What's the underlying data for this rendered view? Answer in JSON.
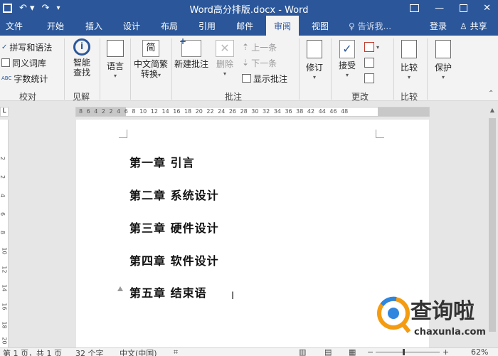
{
  "window": {
    "title": "Word高分排版.docx - Word"
  },
  "tabs": [
    {
      "label": "文件"
    },
    {
      "label": "开始"
    },
    {
      "label": "插入"
    },
    {
      "label": "设计"
    },
    {
      "label": "布局"
    },
    {
      "label": "引用"
    },
    {
      "label": "邮件"
    },
    {
      "label": "审阅",
      "active": true
    },
    {
      "label": "视图"
    }
  ],
  "tell_me": "告诉我...",
  "account": {
    "login": "登录",
    "share": "共享"
  },
  "ribbon": {
    "proofing": {
      "items": [
        "拼写和语法",
        "同义词库",
        "字数统计"
      ],
      "group": "校对"
    },
    "insights": {
      "button": "智能\n查找",
      "line1": "智能",
      "line2": "查找",
      "group": "见解"
    },
    "language": {
      "button": "语言"
    },
    "chinese": {
      "line1": "中文简繁",
      "line2": "转换"
    },
    "comments": {
      "new": "新建批注",
      "delete": "删除",
      "prev": "上一条",
      "next": "下一条",
      "show": "显示批注",
      "group": "批注"
    },
    "tracking": {
      "button": "修订"
    },
    "changes": {
      "accept": "接受",
      "group": "更改"
    },
    "compare": {
      "button": "比较",
      "group": "比较"
    },
    "protect": {
      "button": "保护"
    }
  },
  "ruler": {
    "h_numbers": "8 6 4 2 2 4 6 8 10 12 14 16 18 20 22 24 26 28 30 32 34 36 38 42 44 46 48",
    "v_numbers": [
      "2",
      "2",
      "4",
      "6",
      "8",
      "10",
      "12",
      "14",
      "16",
      "18",
      "20"
    ]
  },
  "document": {
    "headings": [
      "第一章  引言",
      "第二章  系统设计",
      "第三章  硬件设计",
      "第四章  软件设计",
      "第五章  结束语"
    ]
  },
  "status": {
    "page": "第 1 页，共 1 页",
    "words": "32 个字",
    "language": "中文(中国)",
    "zoom": "62%",
    "zoom_level_percent": 62
  },
  "watermark": {
    "cn": "查询啦",
    "url": "chaxunla.com"
  },
  "colors": {
    "word_blue": "#2b579a",
    "ribbon_bg": "#f3f3f3"
  }
}
